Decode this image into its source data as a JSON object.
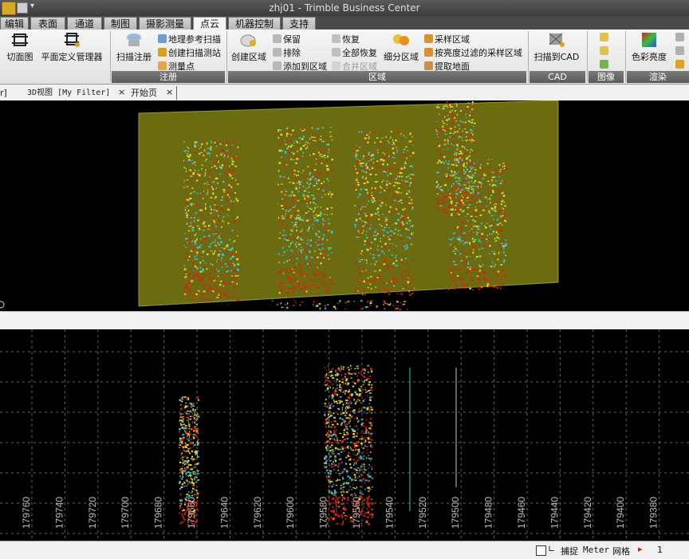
{
  "window": {
    "title": "zhj01 - Trimble Business Center"
  },
  "ribbon_tabs": [
    {
      "label": "编辑",
      "active": false
    },
    {
      "label": "表面",
      "active": false
    },
    {
      "label": "通道",
      "active": false
    },
    {
      "label": "制图",
      "active": false
    },
    {
      "label": "摄影测量",
      "active": false
    },
    {
      "label": "点云",
      "active": true
    },
    {
      "label": "机器控制",
      "active": false
    },
    {
      "label": "支持",
      "active": false
    }
  ],
  "ribbon": {
    "cut_plane": "切面图",
    "plane_manager": "平面定义管理器",
    "scan_register": "扫描注册",
    "geo_reference_scan": "地理参考扫描",
    "create_scan_station": "创建扫描测站",
    "survey_point": "测量点",
    "group_register": "注册",
    "create_region": "创建区域",
    "keep": "保留",
    "exclude": "排除",
    "add_to_region": "添加到区域",
    "restore": "恢复",
    "restore_all": "全部恢复",
    "merge_region": "合并区域",
    "subdivide_region": "细分区域",
    "sample_region": "采样区域",
    "brightness_filter_sample": "按亮度过滤的采样区域",
    "extract_ground": "提取地面",
    "group_region": "区域",
    "scan_to_cad": "扫描到CAD",
    "group_cad": "CAD",
    "group_image": "图像",
    "color_brightness": "色彩亮度",
    "group_render": "渲染"
  },
  "doc_tabs": {
    "tab1_fragment": "r]",
    "tab2": "3D视图 [My Filter]",
    "tab3": "开始页",
    "close": "×"
  },
  "plan_axis_labels": [
    "179760",
    "179740",
    "179720",
    "179700",
    "179680",
    "179660",
    "179640",
    "179620",
    "179600",
    "179580",
    "179560",
    "179540",
    "179520",
    "179500",
    "179480",
    "179460",
    "179440",
    "179420",
    "179400",
    "179380"
  ],
  "statusbar": {
    "snap": "捕捉",
    "unit": "Meter",
    "grid": "网格",
    "page": "1"
  },
  "colors": {
    "ribbon_bg": "#ececec",
    "view_bg": "#000000",
    "plane_fill": "#6b6b12",
    "cloud_red": "#e0200c",
    "cloud_yellow": "#e8d828",
    "cloud_cyan": "#30c8e0"
  }
}
